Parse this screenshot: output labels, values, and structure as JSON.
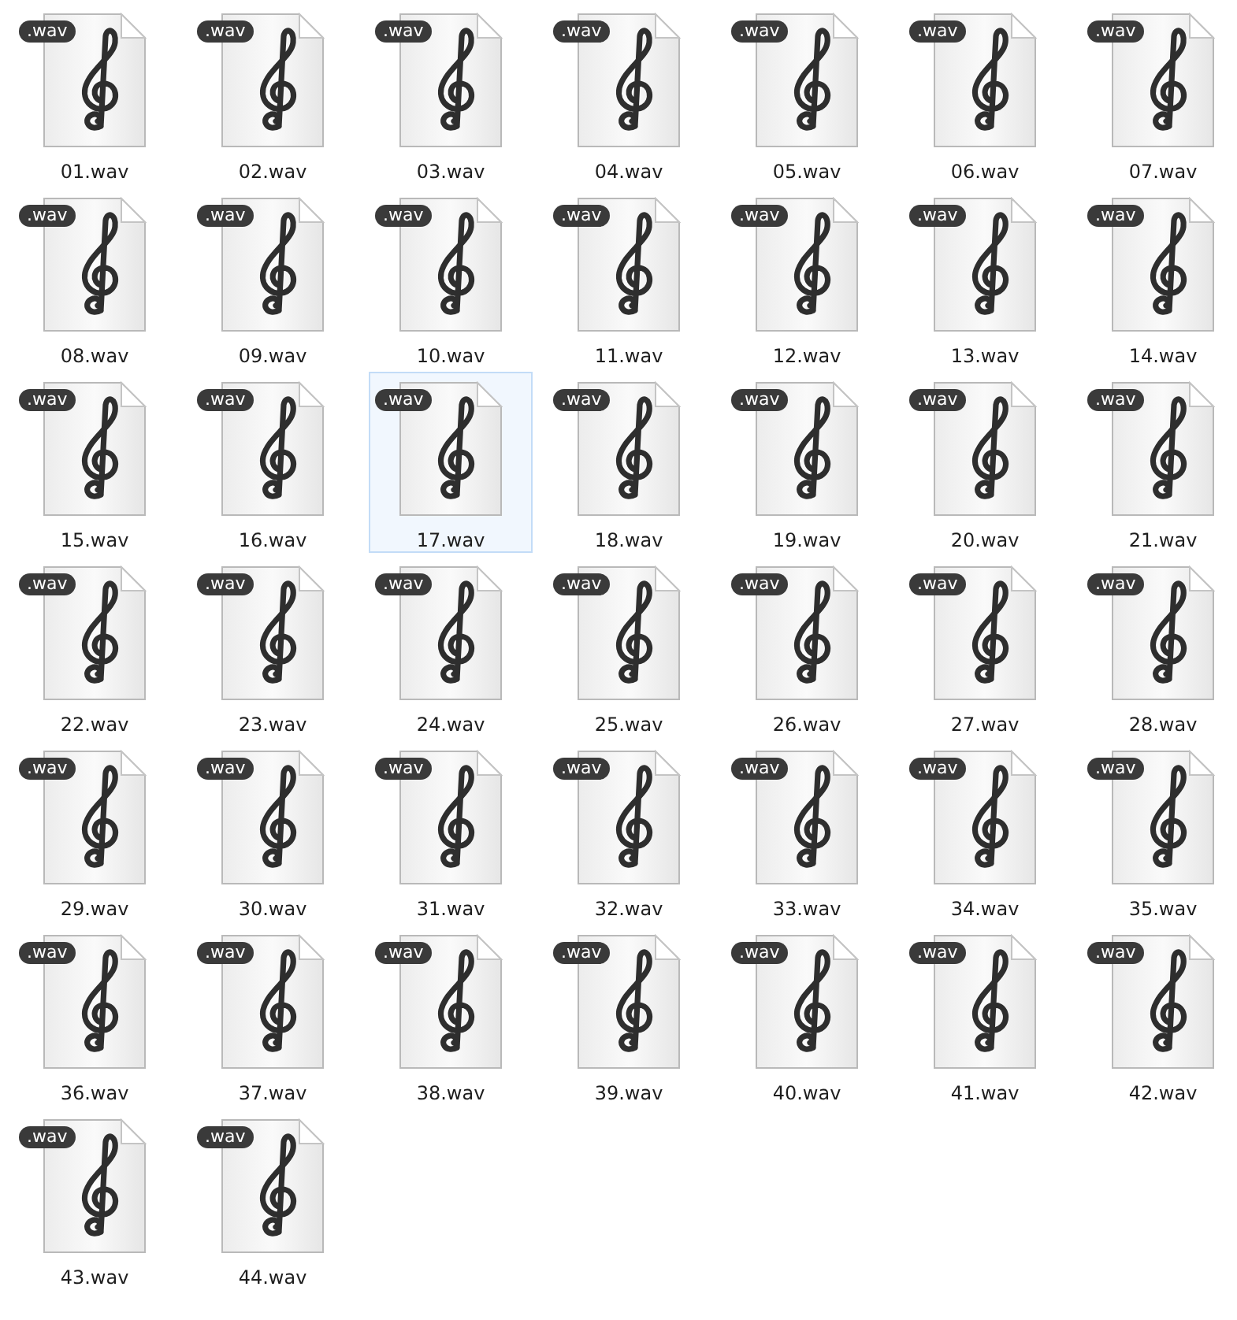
{
  "files": [
    {
      "name": "01.wav",
      "badge": ".wav",
      "selected": false
    },
    {
      "name": "02.wav",
      "badge": ".wav",
      "selected": false
    },
    {
      "name": "03.wav",
      "badge": ".wav",
      "selected": false
    },
    {
      "name": "04.wav",
      "badge": ".wav",
      "selected": false
    },
    {
      "name": "05.wav",
      "badge": ".wav",
      "selected": false
    },
    {
      "name": "06.wav",
      "badge": ".wav",
      "selected": false
    },
    {
      "name": "07.wav",
      "badge": ".wav",
      "selected": false
    },
    {
      "name": "08.wav",
      "badge": ".wav",
      "selected": false
    },
    {
      "name": "09.wav",
      "badge": ".wav",
      "selected": false
    },
    {
      "name": "10.wav",
      "badge": ".wav",
      "selected": false
    },
    {
      "name": "11.wav",
      "badge": ".wav",
      "selected": false
    },
    {
      "name": "12.wav",
      "badge": ".wav",
      "selected": false
    },
    {
      "name": "13.wav",
      "badge": ".wav",
      "selected": false
    },
    {
      "name": "14.wav",
      "badge": ".wav",
      "selected": false
    },
    {
      "name": "15.wav",
      "badge": ".wav",
      "selected": false
    },
    {
      "name": "16.wav",
      "badge": ".wav",
      "selected": false
    },
    {
      "name": "17.wav",
      "badge": ".wav",
      "selected": true
    },
    {
      "name": "18.wav",
      "badge": ".wav",
      "selected": false
    },
    {
      "name": "19.wav",
      "badge": ".wav",
      "selected": false
    },
    {
      "name": "20.wav",
      "badge": ".wav",
      "selected": false
    },
    {
      "name": "21.wav",
      "badge": ".wav",
      "selected": false
    },
    {
      "name": "22.wav",
      "badge": ".wav",
      "selected": false
    },
    {
      "name": "23.wav",
      "badge": ".wav",
      "selected": false
    },
    {
      "name": "24.wav",
      "badge": ".wav",
      "selected": false
    },
    {
      "name": "25.wav",
      "badge": ".wav",
      "selected": false
    },
    {
      "name": "26.wav",
      "badge": ".wav",
      "selected": false
    },
    {
      "name": "27.wav",
      "badge": ".wav",
      "selected": false
    },
    {
      "name": "28.wav",
      "badge": ".wav",
      "selected": false
    },
    {
      "name": "29.wav",
      "badge": ".wav",
      "selected": false
    },
    {
      "name": "30.wav",
      "badge": ".wav",
      "selected": false
    },
    {
      "name": "31.wav",
      "badge": ".wav",
      "selected": false
    },
    {
      "name": "32.wav",
      "badge": ".wav",
      "selected": false
    },
    {
      "name": "33.wav",
      "badge": ".wav",
      "selected": false
    },
    {
      "name": "34.wav",
      "badge": ".wav",
      "selected": false
    },
    {
      "name": "35.wav",
      "badge": ".wav",
      "selected": false
    },
    {
      "name": "36.wav",
      "badge": ".wav",
      "selected": false
    },
    {
      "name": "37.wav",
      "badge": ".wav",
      "selected": false
    },
    {
      "name": "38.wav",
      "badge": ".wav",
      "selected": false
    },
    {
      "name": "39.wav",
      "badge": ".wav",
      "selected": false
    },
    {
      "name": "40.wav",
      "badge": ".wav",
      "selected": false
    },
    {
      "name": "41.wav",
      "badge": ".wav",
      "selected": false
    },
    {
      "name": "42.wav",
      "badge": ".wav",
      "selected": false
    },
    {
      "name": "43.wav",
      "badge": ".wav",
      "selected": false
    },
    {
      "name": "44.wav",
      "badge": ".wav",
      "selected": false
    }
  ]
}
